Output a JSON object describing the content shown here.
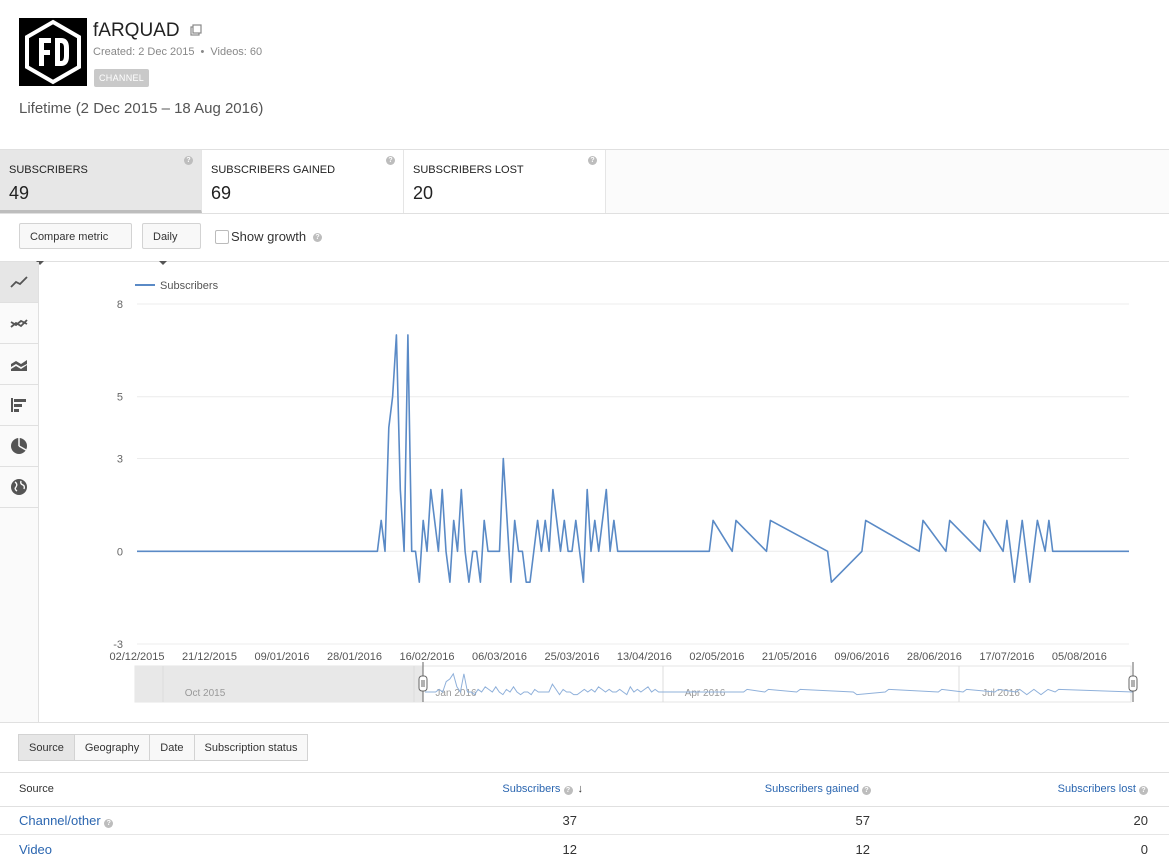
{
  "channel": {
    "title": "fARQUAD",
    "created": "Created: 2 Dec 2015",
    "videos": "Videos: 60",
    "badge": "CHANNEL"
  },
  "period": "Lifetime (2 Dec 2015 – 18 Aug 2016)",
  "metrics": [
    {
      "label": "SUBSCRIBERS",
      "value": "49",
      "active": true
    },
    {
      "label": "SUBSCRIBERS GAINED",
      "value": "69",
      "active": false
    },
    {
      "label": "SUBSCRIBERS LOST",
      "value": "20",
      "active": false
    }
  ],
  "controls": {
    "compare_metric": "Compare metric",
    "interval": "Daily",
    "show_growth": "Show growth"
  },
  "side_icons": [
    "line-chart-icon",
    "multi-line-icon",
    "stacked-area-icon",
    "bar-chart-icon",
    "pie-chart-icon",
    "globe-map-icon"
  ],
  "chart_data": {
    "type": "line",
    "series": [
      {
        "name": "Subscribers",
        "color": "#5a8ac6",
        "x": [
          "2016-02-04",
          "2016-02-06",
          "2016-02-07",
          "2016-02-08",
          "2016-02-09",
          "2016-02-10",
          "2016-02-11",
          "2016-02-12",
          "2016-02-13",
          "2016-02-14",
          "2016-02-15",
          "2016-02-16",
          "2016-02-17",
          "2016-02-18",
          "2016-02-19",
          "2016-02-20",
          "2016-02-21",
          "2016-02-22",
          "2016-02-23",
          "2016-02-24",
          "2016-02-25",
          "2016-02-26",
          "2016-02-27",
          "2016-02-28",
          "2016-02-29",
          "2016-03-01",
          "2016-03-02",
          "2016-03-03",
          "2016-03-04",
          "2016-03-05",
          "2016-03-06",
          "2016-03-07",
          "2016-03-08",
          "2016-03-09",
          "2016-03-10",
          "2016-03-11",
          "2016-03-12",
          "2016-03-13",
          "2016-03-14",
          "2016-03-15",
          "2016-03-16",
          "2016-03-17",
          "2016-03-18",
          "2016-03-19",
          "2016-03-20",
          "2016-03-21",
          "2016-03-22",
          "2016-03-23",
          "2016-03-24",
          "2016-03-25",
          "2016-03-26",
          "2016-03-27",
          "2016-03-28",
          "2016-03-29",
          "2016-03-30",
          "2016-03-31",
          "2016-04-01",
          "2016-04-02",
          "2016-04-03",
          "2016-04-04",
          "2016-04-05",
          "2016-04-06",
          "2016-05-01",
          "2016-05-07",
          "2016-05-16",
          "2016-06-01",
          "2016-06-10",
          "2016-06-25",
          "2016-07-02",
          "2016-07-11",
          "2016-07-17",
          "2016-07-19",
          "2016-07-21",
          "2016-07-23",
          "2016-07-25",
          "2016-07-28"
        ],
        "values": [
          1,
          4,
          5,
          7,
          2,
          0,
          7,
          0,
          0,
          -1,
          1,
          0,
          2,
          1,
          0,
          2,
          0,
          -1,
          1,
          0,
          2,
          0,
          -1,
          0,
          0,
          -1,
          1,
          0,
          0,
          0,
          0,
          3,
          1,
          -1,
          1,
          0,
          0,
          -1,
          -1,
          0,
          1,
          0,
          1,
          0,
          2,
          1,
          0,
          1,
          0,
          0,
          1,
          0,
          -1,
          2,
          0,
          1,
          0,
          1,
          2,
          0,
          1,
          0,
          1,
          1,
          1,
          -1,
          1,
          1,
          1,
          1,
          1,
          -1,
          1,
          -1,
          1,
          1
        ]
      }
    ],
    "x_range": [
      "2015-12-02",
      "2016-08-18"
    ],
    "y_ticks": [
      8,
      5,
      3,
      0,
      -3
    ],
    "x_tick_labels": [
      "02/12/2015",
      "21/12/2015",
      "09/01/2016",
      "28/01/2016",
      "16/02/2016",
      "06/03/2016",
      "25/03/2016",
      "13/04/2016",
      "02/05/2016",
      "21/05/2016",
      "09/06/2016",
      "28/06/2016",
      "17/07/2016",
      "05/08/2016"
    ],
    "legend_position": "top-left",
    "grid": true,
    "navigator_labels": [
      "Oct 2015",
      "Jan 2016",
      "Apr 2016",
      "Jul 2016"
    ]
  },
  "table_tabs": [
    "Source",
    "Geography",
    "Date",
    "Subscription status"
  ],
  "table": {
    "columns": [
      "Source",
      "Subscribers",
      "Subscribers gained",
      "Subscribers lost"
    ],
    "rows": [
      {
        "name": "Channel/other",
        "values": [
          "37",
          "57",
          "20"
        ]
      },
      {
        "name": "Video",
        "values": [
          "12",
          "12",
          "0"
        ]
      }
    ]
  }
}
